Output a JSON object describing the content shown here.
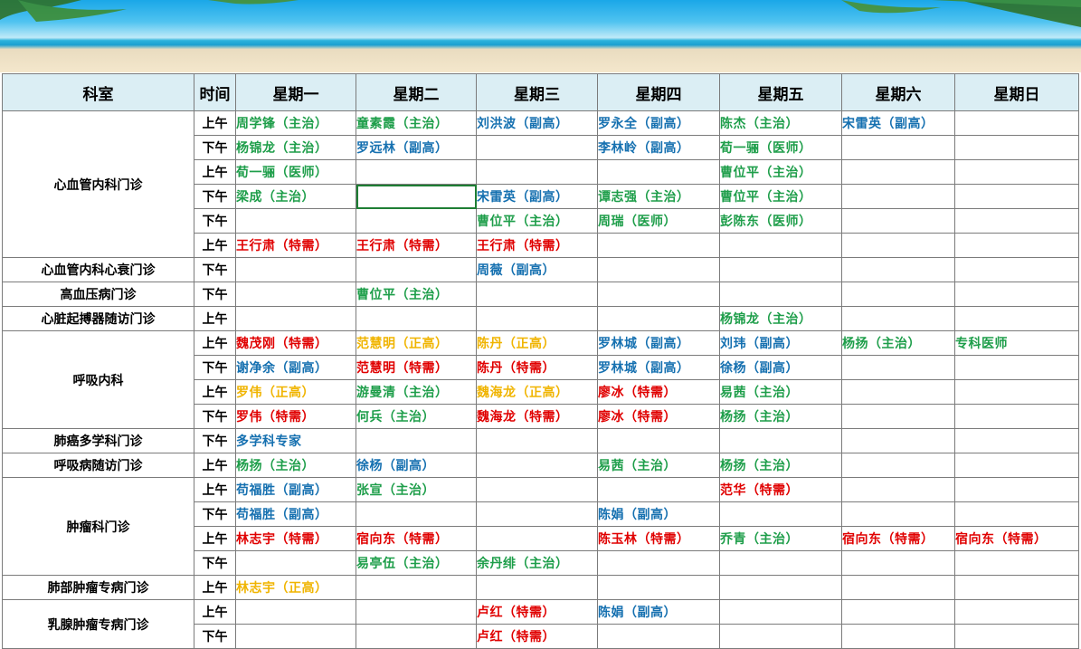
{
  "header": {
    "dept": "科室",
    "time": "时间",
    "days": [
      "星期一",
      "星期二",
      "星期三",
      "星期四",
      "星期五",
      "星期六",
      "星期日"
    ]
  },
  "colors": {
    "green": "#1e9e4a",
    "blue": "#1570b0",
    "red": "#e00000",
    "gold": "#f0b400"
  },
  "departments": [
    {
      "name": "心血管内科门诊",
      "rows": [
        {
          "time": "上午",
          "cells": [
            [
              "周学锋（主治）",
              "green"
            ],
            [
              "童素霞（主治）",
              "green"
            ],
            [
              "刘洪波（副高）",
              "blue"
            ],
            [
              "罗永全（副高）",
              "blue"
            ],
            [
              "陈杰（主治）",
              "green"
            ],
            [
              "宋雷英（副高）",
              "blue"
            ],
            [
              "",
              ""
            ]
          ]
        },
        {
          "time": "下午",
          "cells": [
            [
              "杨锦龙（主治）",
              "green"
            ],
            [
              "罗远林（副高）",
              "blue"
            ],
            [
              "",
              ""
            ],
            [
              "李林岭（副高）",
              "blue"
            ],
            [
              "荀一骊（医师）",
              "green"
            ],
            [
              "",
              ""
            ],
            [
              "",
              ""
            ]
          ]
        },
        {
          "time": "上午",
          "cells": [
            [
              "荀一骊（医师）",
              "green"
            ],
            [
              "",
              ""
            ],
            [
              "",
              ""
            ],
            [
              "",
              ""
            ],
            [
              "曹位平（主治）",
              "green"
            ],
            [
              "",
              ""
            ],
            [
              "",
              ""
            ]
          ]
        },
        {
          "time": "下午",
          "cells": [
            [
              "梁成（主治）",
              "green"
            ],
            [
              "",
              ""
            ],
            [
              "宋雷英（副高）",
              "blue"
            ],
            [
              "谭志强（主治）",
              "green"
            ],
            [
              "曹位平（主治）",
              "green"
            ],
            [
              "",
              ""
            ],
            [
              "",
              ""
            ]
          ]
        },
        {
          "time": "下午",
          "cells": [
            [
              "",
              ""
            ],
            [
              "",
              ""
            ],
            [
              "曹位平（主治）",
              "green"
            ],
            [
              "周瑞（医师）",
              "green"
            ],
            [
              "彭陈东（医师）",
              "green"
            ],
            [
              "",
              ""
            ],
            [
              "",
              ""
            ]
          ]
        },
        {
          "time": "上午",
          "cells": [
            [
              "王行肃（特需）",
              "red"
            ],
            [
              "王行肃（特需）",
              "red"
            ],
            [
              "王行肃（特需）",
              "red"
            ],
            [
              "",
              ""
            ],
            [
              "",
              ""
            ],
            [
              "",
              ""
            ],
            [
              "",
              ""
            ]
          ]
        }
      ]
    },
    {
      "name": "心血管内科心衰门诊",
      "rows": [
        {
          "time": "下午",
          "cells": [
            [
              "",
              ""
            ],
            [
              "",
              ""
            ],
            [
              "周薇（副高）",
              "blue"
            ],
            [
              "",
              ""
            ],
            [
              "",
              ""
            ],
            [
              "",
              ""
            ],
            [
              "",
              ""
            ]
          ]
        }
      ]
    },
    {
      "name": "高血压病门诊",
      "rows": [
        {
          "time": "下午",
          "cells": [
            [
              "",
              ""
            ],
            [
              "曹位平（主治）",
              "green"
            ],
            [
              "",
              ""
            ],
            [
              "",
              ""
            ],
            [
              "",
              ""
            ],
            [
              "",
              ""
            ],
            [
              "",
              ""
            ]
          ]
        }
      ]
    },
    {
      "name": "心脏起搏器随访门诊",
      "rows": [
        {
          "time": "上午",
          "cells": [
            [
              "",
              ""
            ],
            [
              "",
              ""
            ],
            [
              "",
              ""
            ],
            [
              "",
              ""
            ],
            [
              "杨锦龙（主治）",
              "green"
            ],
            [
              "",
              ""
            ],
            [
              "",
              ""
            ]
          ]
        }
      ]
    },
    {
      "name": "呼吸内科",
      "rows": [
        {
          "time": "上午",
          "cells": [
            [
              "魏茂刚（特需）",
              "red"
            ],
            [
              "范慧明（正高）",
              "gold"
            ],
            [
              "陈丹（正高）",
              "gold"
            ],
            [
              "罗林城（副高）",
              "blue"
            ],
            [
              "刘玮（副高）",
              "blue"
            ],
            [
              "杨扬（主治）",
              "green"
            ],
            [
              "专科医师",
              "green"
            ]
          ]
        },
        {
          "time": "下午",
          "cells": [
            [
              "谢净余（副高）",
              "blue"
            ],
            [
              "范慧明（特需）",
              "red"
            ],
            [
              "陈丹（特需）",
              "red"
            ],
            [
              "罗林城（副高）",
              "blue"
            ],
            [
              "徐杨（副高）",
              "blue"
            ],
            [
              "",
              ""
            ],
            [
              "",
              ""
            ]
          ]
        },
        {
          "time": "上午",
          "cells": [
            [
              "罗伟（正高）",
              "gold"
            ],
            [
              "游曼清（主治）",
              "green"
            ],
            [
              "魏海龙（正高）",
              "gold"
            ],
            [
              "廖冰（特需）",
              "red"
            ],
            [
              "易茜（主治）",
              "green"
            ],
            [
              "",
              ""
            ],
            [
              "",
              ""
            ]
          ]
        },
        {
          "time": "下午",
          "cells": [
            [
              "罗伟（特需）",
              "red"
            ],
            [
              "何兵（主治）",
              "green"
            ],
            [
              "魏海龙（特需）",
              "red"
            ],
            [
              "廖冰（特需）",
              "red"
            ],
            [
              "杨扬（主治）",
              "green"
            ],
            [
              "",
              ""
            ],
            [
              "",
              ""
            ]
          ]
        }
      ]
    },
    {
      "name": "肺癌多学科门诊",
      "rows": [
        {
          "time": "下午",
          "cells": [
            [
              "多学科专家",
              "blue"
            ],
            [
              "",
              ""
            ],
            [
              "",
              ""
            ],
            [
              "",
              ""
            ],
            [
              "",
              ""
            ],
            [
              "",
              ""
            ],
            [
              "",
              ""
            ]
          ]
        }
      ]
    },
    {
      "name": "呼吸病随访门诊",
      "rows": [
        {
          "time": "上午",
          "cells": [
            [
              "杨扬（主治）",
              "green"
            ],
            [
              "徐杨（副高）",
              "blue"
            ],
            [
              "",
              ""
            ],
            [
              "易茜（主治）",
              "green"
            ],
            [
              "杨扬（主治）",
              "green"
            ],
            [
              "",
              ""
            ],
            [
              "",
              ""
            ]
          ]
        }
      ]
    },
    {
      "name": "肿瘤科门诊",
      "rows": [
        {
          "time": "上午",
          "cells": [
            [
              "苟福胜（副高）",
              "blue"
            ],
            [
              "张宣（主治）",
              "green"
            ],
            [
              "",
              ""
            ],
            [
              "",
              ""
            ],
            [
              "范华（特需）",
              "red"
            ],
            [
              "",
              ""
            ],
            [
              "",
              ""
            ]
          ]
        },
        {
          "time": "下午",
          "cells": [
            [
              "苟福胜（副高）",
              "blue"
            ],
            [
              "",
              ""
            ],
            [
              "",
              ""
            ],
            [
              "陈娟（副高）",
              "blue"
            ],
            [
              "",
              ""
            ],
            [
              "",
              ""
            ],
            [
              "",
              ""
            ]
          ]
        },
        {
          "time": "上午",
          "cells": [
            [
              "林志宇（特需）",
              "red"
            ],
            [
              "宿向东（特需）",
              "red"
            ],
            [
              "",
              ""
            ],
            [
              "陈玉林（特需）",
              "red"
            ],
            [
              "乔青（主治）",
              "green"
            ],
            [
              "宿向东（特需）",
              "red"
            ],
            [
              "宿向东（特需）",
              "red"
            ]
          ]
        },
        {
          "time": "下午",
          "cells": [
            [
              "",
              ""
            ],
            [
              "易亭伍（主治）",
              "green"
            ],
            [
              "余丹绯（主治）",
              "green"
            ],
            [
              "",
              ""
            ],
            [
              "",
              ""
            ],
            [
              "",
              ""
            ],
            [
              "",
              ""
            ]
          ]
        }
      ]
    },
    {
      "name": "肺部肿瘤专病门诊",
      "rows": [
        {
          "time": "上午",
          "cells": [
            [
              "林志宇（正高）",
              "gold"
            ],
            [
              "",
              ""
            ],
            [
              "",
              ""
            ],
            [
              "",
              ""
            ],
            [
              "",
              ""
            ],
            [
              "",
              ""
            ],
            [
              "",
              ""
            ]
          ]
        }
      ]
    },
    {
      "name": "乳腺肿瘤专病门诊",
      "rows": [
        {
          "time": "上午",
          "cells": [
            [
              "",
              ""
            ],
            [
              "",
              ""
            ],
            [
              "卢红（特需）",
              "red"
            ],
            [
              "陈娟（副高）",
              "blue"
            ],
            [
              "",
              ""
            ],
            [
              "",
              ""
            ],
            [
              "",
              ""
            ]
          ]
        },
        {
          "time": "下午",
          "cells": [
            [
              "",
              ""
            ],
            [
              "",
              ""
            ],
            [
              "卢红（特需）",
              "red"
            ],
            [
              "",
              ""
            ],
            [
              "",
              ""
            ],
            [
              "",
              ""
            ],
            [
              "",
              ""
            ]
          ]
        }
      ]
    }
  ]
}
